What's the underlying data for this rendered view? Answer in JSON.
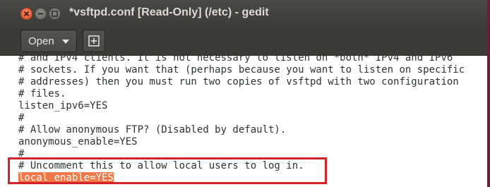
{
  "window": {
    "title": "*vsftpd.conf [Read-Only] (/etc) - gedit"
  },
  "toolbar": {
    "open_label": "Open",
    "open_icon": "chevron-down-icon",
    "new_tab_icon": "new-document-icon"
  },
  "editor": {
    "lines": [
      "# and IPv4 clients. It is not necessary to listen on *both* IPv4 and IPv6",
      "# sockets. If you want that (perhaps because you want to listen on specific",
      "# addresses) then you must run two copies of vsftpd with two configuration",
      "# files.",
      "listen_ipv6=YES",
      "#",
      "# Allow anonymous FTP? (Disabled by default).",
      "anonymous_enable=YES",
      "#",
      "# Uncomment this to allow local users to log in.",
      "local_enable=YES"
    ],
    "selection_color": "#f07746",
    "annotation_color": "#d2232a"
  }
}
